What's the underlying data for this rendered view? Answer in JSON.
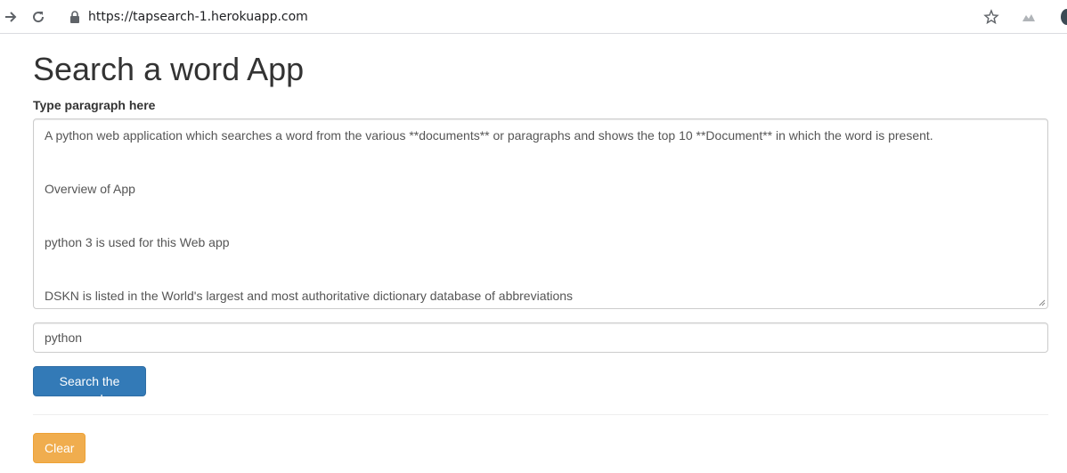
{
  "browser": {
    "url": "https://tapsearch-1.herokuapp.com",
    "icons": [
      "forward-icon",
      "reload-icon",
      "lock-icon",
      "star-icon",
      "extension-icon",
      "profile-avatar"
    ]
  },
  "page": {
    "title": "Search a word App",
    "paragraph_label": "Type paragraph here",
    "paragraph_lines": [
      "A python web application which searches a word from the various **documents** or paragraphs and shows the top 10 **Document** in which the word is present.",
      "Overview of App",
      "python 3 is used for this Web app",
      "DSKN is listed in the World's largest and most authoritative dictionary database of abbreviations"
    ],
    "search_input_value": "python",
    "search_button_label": "Search the word",
    "clear_button_label": "Clear"
  },
  "colors": {
    "primary": "#337ab7",
    "warning": "#f0ad4e",
    "text": "#333333"
  }
}
